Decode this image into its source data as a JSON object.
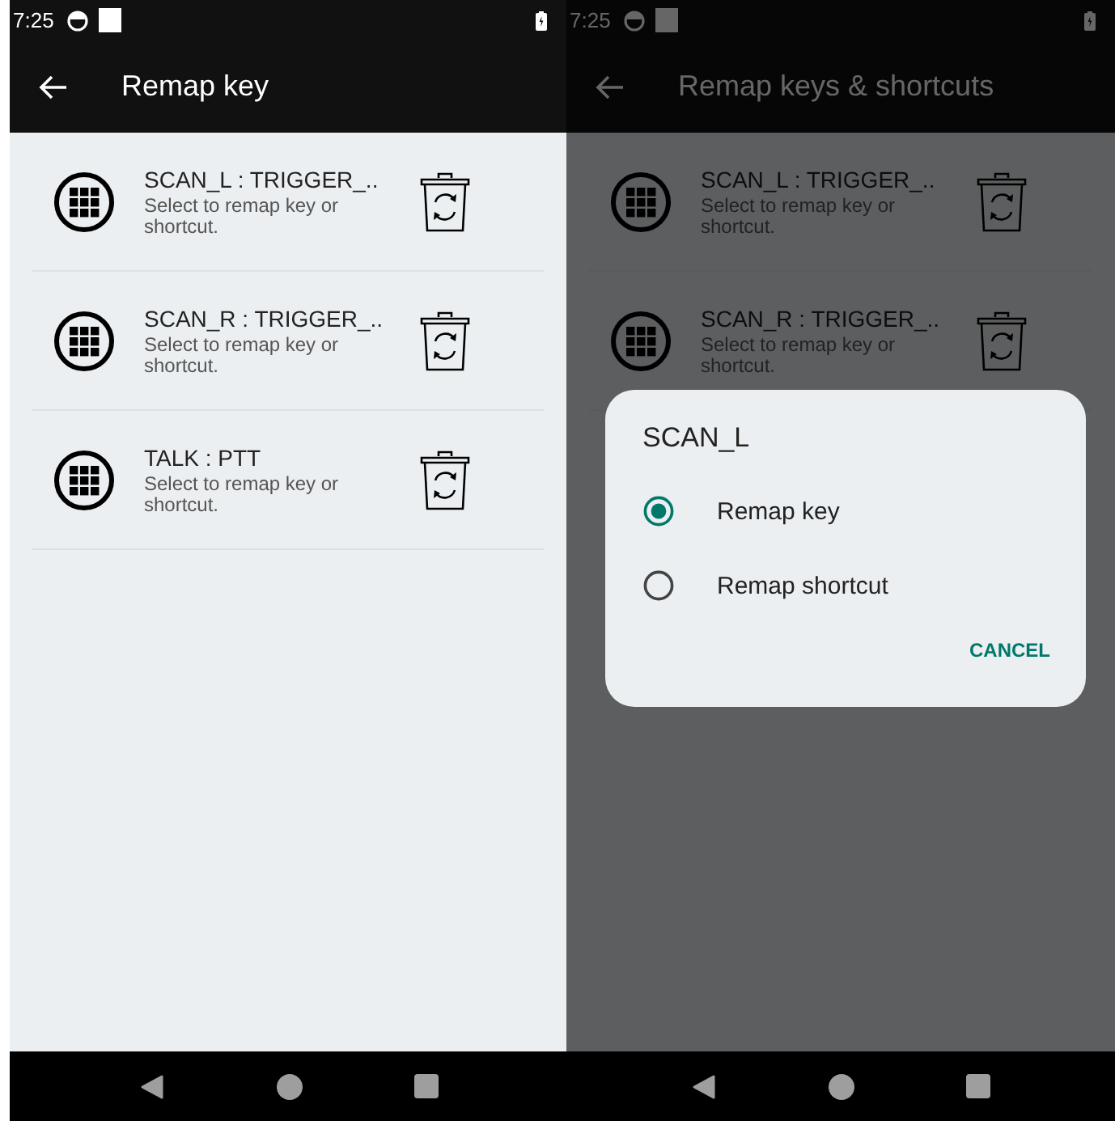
{
  "screens": [
    {
      "status_time": "7:25",
      "title": "Remap key",
      "dimmed": false,
      "rows": [
        {
          "name": "SCAN_L : TRIGGER_..",
          "hint": "Select to remap key or shortcut."
        },
        {
          "name": "SCAN_R : TRIGGER_..",
          "hint": "Select to remap key or shortcut."
        },
        {
          "name": "TALK : PTT",
          "hint": "Select to remap key or shortcut."
        }
      ]
    },
    {
      "status_time": "7:25",
      "title": "Remap keys & shortcuts",
      "dimmed": true,
      "rows": [
        {
          "name": "SCAN_L : TRIGGER_..",
          "hint": "Select to remap key or shortcut."
        },
        {
          "name": "SCAN_R : TRIGGER_..",
          "hint": "Select to remap key or shortcut."
        }
      ],
      "dialog": {
        "title": "SCAN_L",
        "options": [
          {
            "label": "Remap key",
            "selected": true
          },
          {
            "label": "Remap shortcut",
            "selected": false
          }
        ],
        "button": "CANCEL"
      }
    }
  ]
}
